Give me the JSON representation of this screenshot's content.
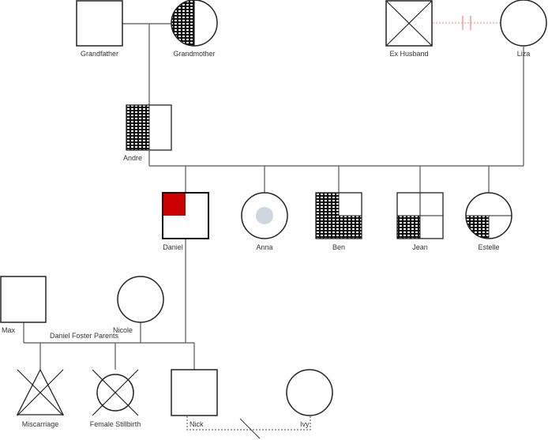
{
  "diagram": {
    "type": "genogram",
    "colors": {
      "affected_red": "#cc0000",
      "carrier_dot": "#cfd6df",
      "divorce_line": "#f08080",
      "stroke": "#222222"
    },
    "people": {
      "grandfather": {
        "label": "Grandfather",
        "gender": "male",
        "status": "unaffected"
      },
      "grandmother": {
        "label": "Grandmother",
        "gender": "female",
        "status": "left-half-pattern"
      },
      "ex_husband": {
        "label": "Ex Husband",
        "gender": "male",
        "status": "deceased"
      },
      "liza": {
        "label": "Liza",
        "gender": "female",
        "status": "unaffected"
      },
      "andre": {
        "label": "Andre",
        "gender": "male",
        "status": "left-half-pattern"
      },
      "daniel": {
        "label": "Daniel",
        "gender": "male",
        "status": "top-left-quadrant-red"
      },
      "anna": {
        "label": "Anna",
        "gender": "female",
        "status": "carrier"
      },
      "ben": {
        "label": "Ben",
        "gender": "male",
        "status": "three-quadrants-pattern"
      },
      "jean": {
        "label": "Jean",
        "gender": "male",
        "status": "bottom-left-quadrant-pattern"
      },
      "estelle": {
        "label": "Estelle",
        "gender": "female",
        "status": "bottom-left-quadrant-pattern"
      },
      "max": {
        "label": "Max",
        "gender": "male",
        "status": "unaffected"
      },
      "nicole": {
        "label": "Nicole",
        "gender": "female",
        "status": "unaffected"
      },
      "miscarriage": {
        "label": "Miscarriage",
        "gender": "unknown",
        "status": "miscarriage"
      },
      "female_stillbirth": {
        "label": "Female Stillbirth",
        "gender": "female",
        "status": "stillbirth"
      },
      "nick": {
        "label": "Nick",
        "gender": "male",
        "status": "unaffected"
      },
      "ivy": {
        "label": "Ivy",
        "gender": "female",
        "status": "unaffected"
      }
    },
    "relationships": {
      "foster_label": "Daniel Foster Parents",
      "grandparents": "married",
      "ex_husband_liza": "divorced",
      "andre_liza": "partners",
      "nick_ivy": "separated-relationship"
    }
  }
}
